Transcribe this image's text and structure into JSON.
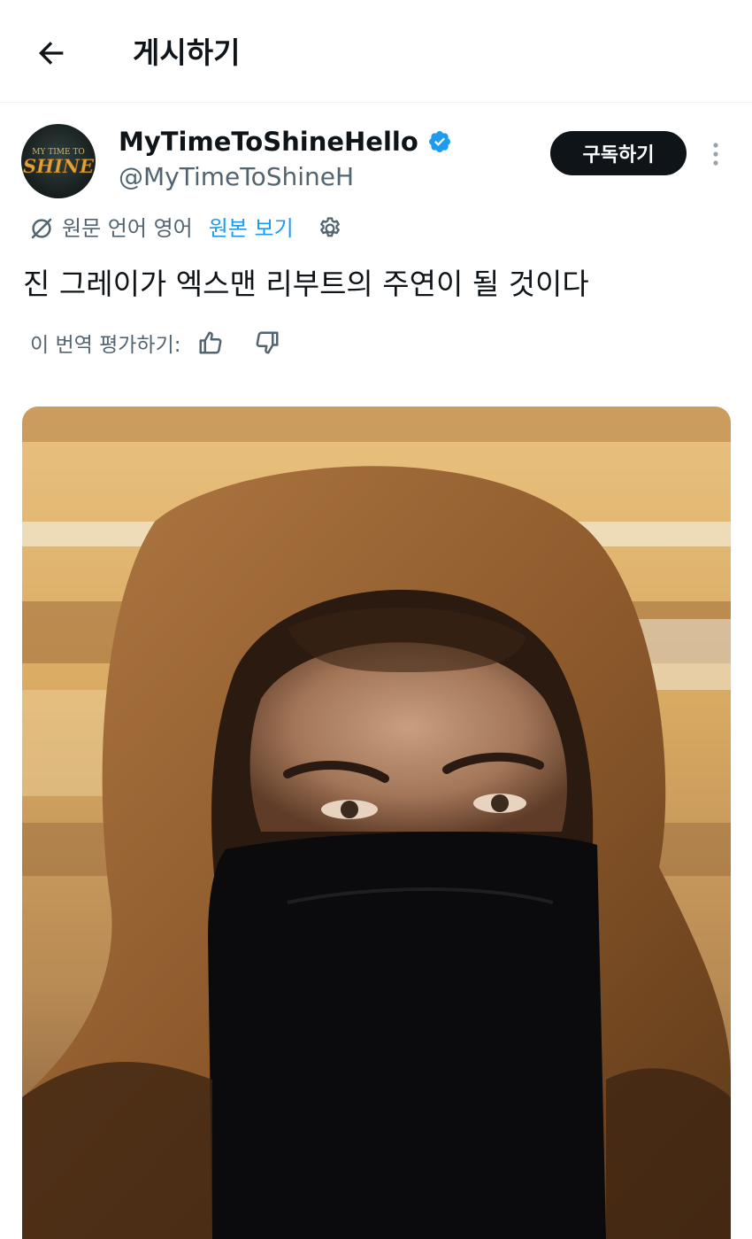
{
  "header": {
    "title": "게시하기"
  },
  "post": {
    "author": {
      "display_name": "MyTimeToShineHello",
      "handle": "@MyTimeToShineH",
      "verified": true,
      "avatar_text_top": "MY TIME TO",
      "avatar_text_main": "SHINE"
    },
    "subscribe_label": "구독하기",
    "translation": {
      "source_language": "원문 언어 영어",
      "show_original": "원본 보기"
    },
    "text": "진 그레이가 엑스맨 리부트의 주연이 될 것이다",
    "rate_translation": "이 번역 평가하기:"
  },
  "colors": {
    "accent": "#1d9bf0",
    "text_primary": "#0f1419",
    "text_secondary": "#536471",
    "button_dark": "#0f1419"
  },
  "icons": [
    "back-arrow-icon",
    "verified-badge-icon",
    "more-vertical-icon",
    "translate-icon",
    "gear-icon",
    "thumbs-up-icon",
    "thumbs-down-icon"
  ]
}
